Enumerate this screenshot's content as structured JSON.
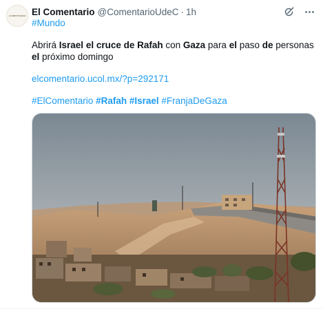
{
  "tweet": {
    "avatar_text": "COMENTARIO",
    "display_name": "El Comentario",
    "handle": "@ComentarioUdeC",
    "separator": "·",
    "time": "1h",
    "hashtag_top": "#Mundo",
    "text_parts": [
      {
        "t": "Abrirá ",
        "b": false
      },
      {
        "t": "Israel",
        "b": true
      },
      {
        "t": " ",
        "b": false
      },
      {
        "t": "el cruce de Rafah",
        "b": true
      },
      {
        "t": " con ",
        "b": false
      },
      {
        "t": "Gaza",
        "b": true
      },
      {
        "t": " para ",
        "b": false
      },
      {
        "t": "el",
        "b": true
      },
      {
        "t": " paso ",
        "b": false
      },
      {
        "t": "de",
        "b": true
      },
      {
        "t": " personas ",
        "b": false
      },
      {
        "t": "el",
        "b": true
      },
      {
        "t": " próximo domingo",
        "b": false
      }
    ],
    "link": "elcomentario.ucol.mx/?p=292171",
    "tags": [
      {
        "t": "#ElComentario",
        "b": false
      },
      {
        "t": "#Rafah",
        "b": true
      },
      {
        "t": "#Israel",
        "b": true
      },
      {
        "t": "#FranjaDeGaza",
        "b": false
      }
    ],
    "icons": {
      "grok": "grok-icon",
      "more": "more-icon"
    },
    "colors": {
      "accent": "#1d9bf0",
      "text": "#0f1419",
      "muted": "#536471"
    }
  }
}
